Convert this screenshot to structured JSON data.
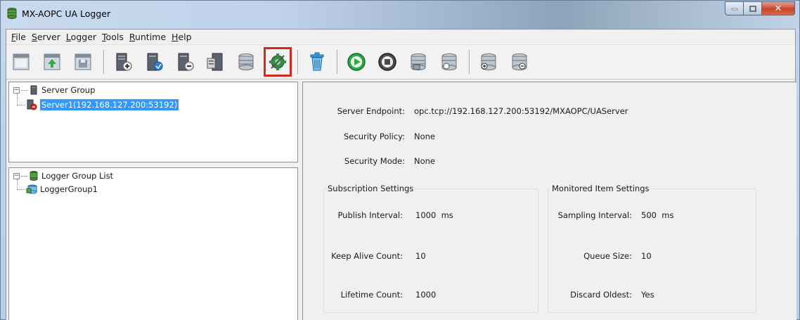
{
  "window": {
    "title": "MX-AOPC UA Logger"
  },
  "menu": [
    {
      "key": "F",
      "rest": "ile"
    },
    {
      "key": "S",
      "rest": "erver"
    },
    {
      "key": "L",
      "rest": "ogger"
    },
    {
      "key": "T",
      "rest": "ools"
    },
    {
      "key": "R",
      "rest": "untime"
    },
    {
      "key": "H",
      "rest": "elp"
    }
  ],
  "toolbar": {
    "icons": [
      "new-project-icon",
      "open-project-icon",
      "save-project-icon",
      "add-server-icon",
      "connect-server-icon",
      "remove-server-icon",
      "server-properties-icon",
      "add-logger-group-icon",
      "server-configuration-icon",
      "delete-icon",
      "start-icon",
      "stop-icon",
      "database-icon",
      "database-properties-icon",
      "add-database-icon",
      "remove-database-icon"
    ],
    "highlighted": "server-configuration-icon"
  },
  "server_tree": {
    "root": "Server Group",
    "child": "Server1(192.168.127.200:53192)"
  },
  "logger_tree": {
    "root": "Logger Group List",
    "child": "LoggerGroup1"
  },
  "details": {
    "endpoint_label": "Server Endpoint:",
    "endpoint_value": "opc.tcp://192.168.127.200:53192/MXAOPC/UAServer",
    "policy_label": "Security Policy:",
    "policy_value": "None",
    "mode_label": "Security Mode:",
    "mode_value": "None"
  },
  "subscription": {
    "title": "Subscription Settings",
    "publish_label": "Publish Interval:",
    "publish_value": "1000  ms",
    "keepalive_label": "Keep Alive Count:",
    "keepalive_value": "10",
    "lifetime_label": "Lifetime Count:",
    "lifetime_value": "1000"
  },
  "monitored": {
    "title": "Monitored Item Settings",
    "sampling_label": "Sampling Interval:",
    "sampling_value": "500  ms",
    "queue_label": "Queue Size:",
    "queue_value": "10",
    "discard_label": "Discard Oldest:",
    "discard_value": "Yes"
  },
  "colors": {
    "selection": "#3399ff",
    "highlight_box": "#d42a1e",
    "start_green": "#2fa84a"
  }
}
